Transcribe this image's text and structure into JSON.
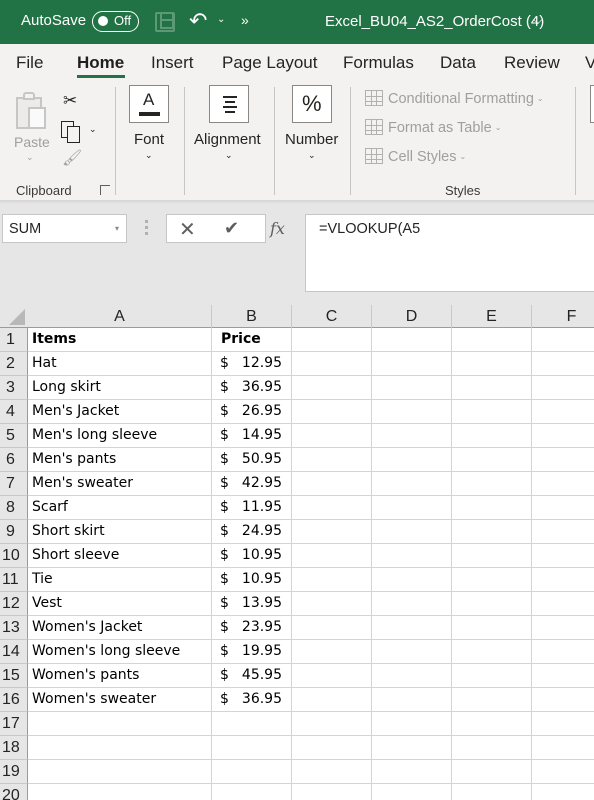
{
  "titlebar": {
    "autosave_label": "AutoSave",
    "autosave_state": "Off",
    "document_title": "Excel_BU04_AS2_OrderCost (4)",
    "icons": [
      "save-icon",
      "undo-icon",
      "undo-dropdown-icon",
      "more-commands-icon",
      "title-chevron-icon"
    ],
    "undo_glyph": "↶",
    "dropdown_glyph": "⌄",
    "more_glyph": "»",
    "title_chevron": "⌵",
    "background_color": "#217346"
  },
  "ribbon": {
    "tabs": [
      {
        "label": "File",
        "active": false
      },
      {
        "label": "Home",
        "active": true
      },
      {
        "label": "Insert",
        "active": false
      },
      {
        "label": "Page Layout",
        "active": false
      },
      {
        "label": "Formulas",
        "active": false
      },
      {
        "label": "Data",
        "active": false
      },
      {
        "label": "Review",
        "active": false
      },
      {
        "label": "V",
        "active": false
      }
    ],
    "accent_color": "#217346",
    "clipboard": {
      "paste_label": "Paste",
      "group_label": "Clipboard",
      "cut_glyph": "✂",
      "painter_glyph": "🖌",
      "chev": "⌄",
      "launcher_glyph": "↘"
    },
    "font": {
      "label": "Font",
      "glyph": "A",
      "chev": "⌄"
    },
    "alignment": {
      "label": "Alignment",
      "chev": "⌄"
    },
    "number": {
      "label": "Number",
      "glyph": "%",
      "chev": "⌄"
    },
    "styles": {
      "group_label": "Styles",
      "items": [
        {
          "label": "Conditional Formatting",
          "chev": "⌄"
        },
        {
          "label": "Format as Table",
          "chev": "⌄"
        },
        {
          "label": "Cell Styles",
          "chev": "⌄"
        }
      ]
    }
  },
  "formula_bar": {
    "name_box": "SUM",
    "name_box_chev": "▾",
    "cancel_glyph": "✕",
    "enter_glyph": "✔",
    "fx_glyph": "fx",
    "formula": "=VLOOKUP(A5"
  },
  "sheet": {
    "columns": [
      "A",
      "B",
      "C",
      "D",
      "E",
      "F"
    ],
    "header": {
      "items": "Items",
      "price": "Price"
    },
    "currency_symbol": "$",
    "rows": [
      {
        "num": "1",
        "item": "Items",
        "price": "",
        "header": true
      },
      {
        "num": "2",
        "item": "Hat",
        "price": "12.95"
      },
      {
        "num": "3",
        "item": "Long skirt",
        "price": "36.95"
      },
      {
        "num": "4",
        "item": "Men's Jacket",
        "price": "26.95"
      },
      {
        "num": "5",
        "item": "Men's long sleeve",
        "price": "14.95"
      },
      {
        "num": "6",
        "item": "Men's pants",
        "price": "50.95"
      },
      {
        "num": "7",
        "item": "Men's sweater",
        "price": "42.95"
      },
      {
        "num": "8",
        "item": "Scarf",
        "price": "11.95"
      },
      {
        "num": "9",
        "item": "Short skirt",
        "price": "24.95"
      },
      {
        "num": "10",
        "item": "Short sleeve",
        "price": "10.95"
      },
      {
        "num": "11",
        "item": "Tie",
        "price": "10.95"
      },
      {
        "num": "12",
        "item": "Vest",
        "price": "13.95"
      },
      {
        "num": "13",
        "item": "Women's Jacket",
        "price": "23.95"
      },
      {
        "num": "14",
        "item": "Women's long sleeve",
        "price": "19.95"
      },
      {
        "num": "15",
        "item": "Women's pants",
        "price": "45.95"
      },
      {
        "num": "16",
        "item": "Women's sweater",
        "price": "36.95"
      },
      {
        "num": "17",
        "item": "",
        "price": ""
      },
      {
        "num": "18",
        "item": "",
        "price": ""
      },
      {
        "num": "19",
        "item": "",
        "price": ""
      },
      {
        "num": "20",
        "item": "",
        "price": ""
      }
    ]
  }
}
